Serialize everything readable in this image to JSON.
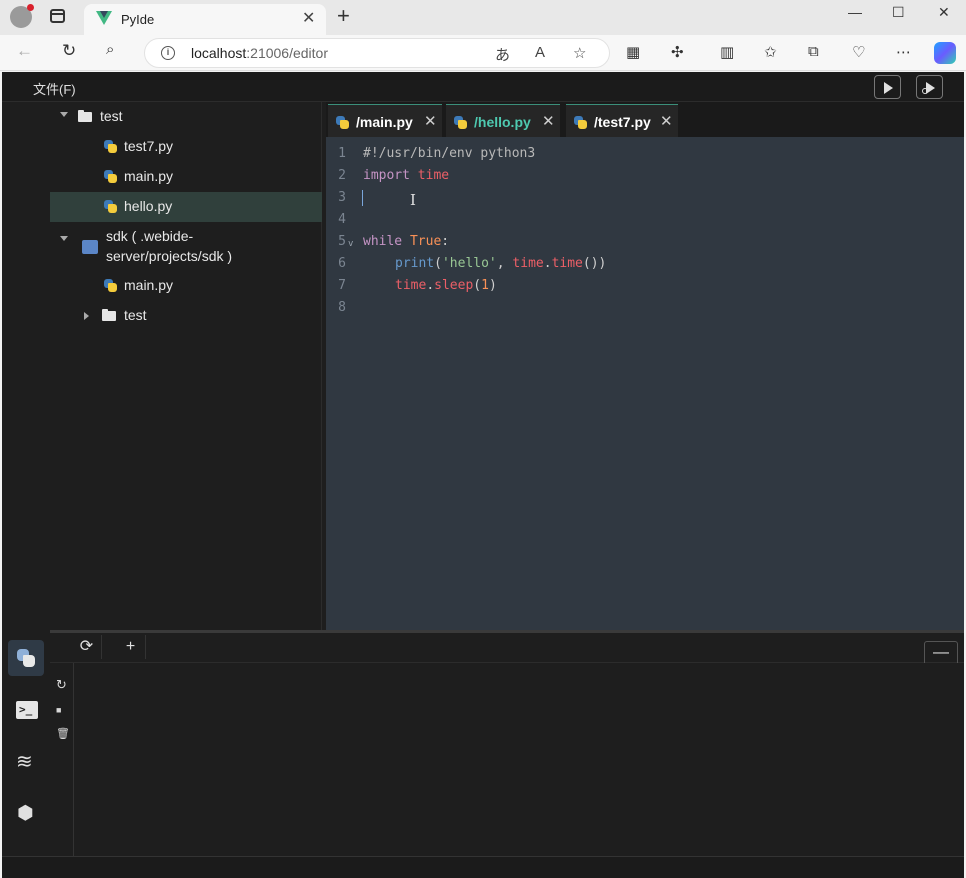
{
  "browser": {
    "tab_title": "PyIde",
    "url_host": "localhost",
    "url_rest": ":21006/editor",
    "tab_close": "✕",
    "new_tab": "+",
    "minimize": "—",
    "maximize": "☐",
    "close": "✕"
  },
  "app": {
    "menu": {
      "file": "文件(F)"
    },
    "explorer": {
      "items": [
        {
          "label": "test",
          "type": "folder",
          "expanded": true
        },
        {
          "label": "test7.py",
          "type": "python-file"
        },
        {
          "label": "main.py",
          "type": "python-file"
        },
        {
          "label": "hello.py",
          "type": "python-file",
          "selected": true
        },
        {
          "label": "sdk ( .webide-",
          "label2": "server/projects/sdk )",
          "type": "project",
          "expanded": true
        },
        {
          "label": "main.py",
          "type": "python-file"
        },
        {
          "label": "test",
          "type": "folder",
          "expanded": false
        }
      ]
    },
    "editor": {
      "tabs": [
        {
          "label": "/main.py",
          "close": "✕",
          "active": false
        },
        {
          "label": "/hello.py",
          "close": "✕",
          "active": true
        },
        {
          "label": "/test7.py",
          "close": "✕",
          "active": false
        }
      ],
      "line_numbers": [
        "1",
        "2",
        "3",
        "4",
        "5",
        "6",
        "7",
        "8"
      ],
      "code": {
        "l1": "#!/usr/bin/env python3",
        "l2_kw": "import",
        "l2_mod": "time",
        "l5_kw": "while",
        "l5_const": "True",
        "l5_colon": ":",
        "l6_fn": "print",
        "l6_open": "(",
        "l6_str": "'hello'",
        "l6_comma": ", ",
        "l6_mod": "time",
        "l6_dot": ".",
        "l6_call": "time",
        "l6_close": "())",
        "l7_mod": "time",
        "l7_dot": ".",
        "l7_call": "sleep",
        "l7_open": "(",
        "l7_num": "1",
        "l7_close": ")"
      },
      "fold_marker": "v",
      "text_cursor": "I"
    },
    "panel": {
      "refresh_label": "⟳",
      "add_label": "+",
      "minimize_label": "—",
      "side_restart": "↻",
      "side_stop": "■",
      "side_delete": "🗑"
    }
  },
  "colors": {
    "editor_bg": "#303841",
    "app_bg": "#1e1e1e",
    "active_tab_text": "#4ec9b0",
    "selected_row": "#30403c"
  }
}
